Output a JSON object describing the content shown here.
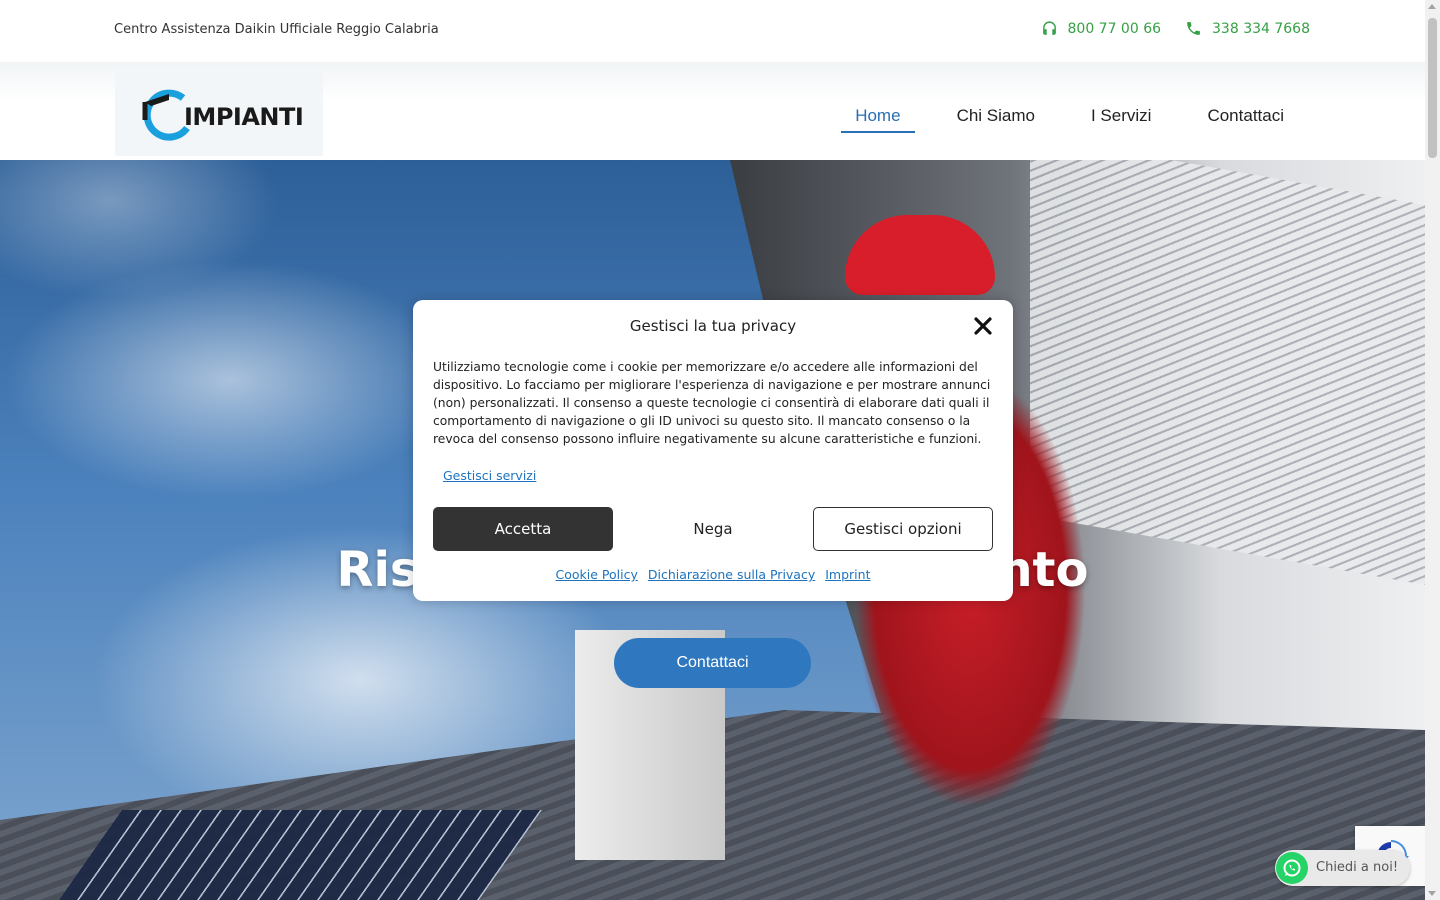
{
  "topbar": {
    "info": "Centro Assistenza Daikin Ufficiale Reggio Calabria",
    "phone1": "800 77 00 66",
    "phone2": "338 334 7668",
    "phone_icon1": "headset-icon",
    "phone_icon2": "phone-icon",
    "accent_color": "#35a045"
  },
  "header": {
    "logo_text": "IMPIANTI",
    "nav": [
      {
        "label": "Home",
        "active": true
      },
      {
        "label": "Chi Siamo",
        "active": false
      },
      {
        "label": "I Servizi",
        "active": false
      },
      {
        "label": "Contattaci",
        "active": false
      }
    ],
    "nav_active_color": "#2a6fb5"
  },
  "hero": {
    "title_visible": "Riscal",
    "title_visible_end": "mento",
    "cta_label": "Contattaci",
    "cta_color": "#2f78c0"
  },
  "cookie_modal": {
    "title": "Gestisci la tua privacy",
    "body": "Utilizziamo tecnologie come i cookie per memorizzare e/o accedere alle informazioni del dispositivo. Lo facciamo per migliorare l'esperienza di navigazione e per mostrare annunci (non) personalizzati. Il consenso a queste tecnologie ci consentirà di elaborare dati quali il comportamento di navigazione o gli ID univoci su questo sito. Il mancato consenso o la revoca del consenso possono influire negativamente su alcune caratteristiche e funzioni.",
    "manage_services": "Gestisci servizi",
    "accept": "Accetta",
    "deny": "Nega",
    "options": "Gestisci opzioni",
    "links": [
      "Cookie Policy",
      "Dichiarazione sulla Privacy",
      "Imprint"
    ]
  },
  "whatsapp": {
    "label": "Chiedi a noi!",
    "color": "#25d366"
  }
}
